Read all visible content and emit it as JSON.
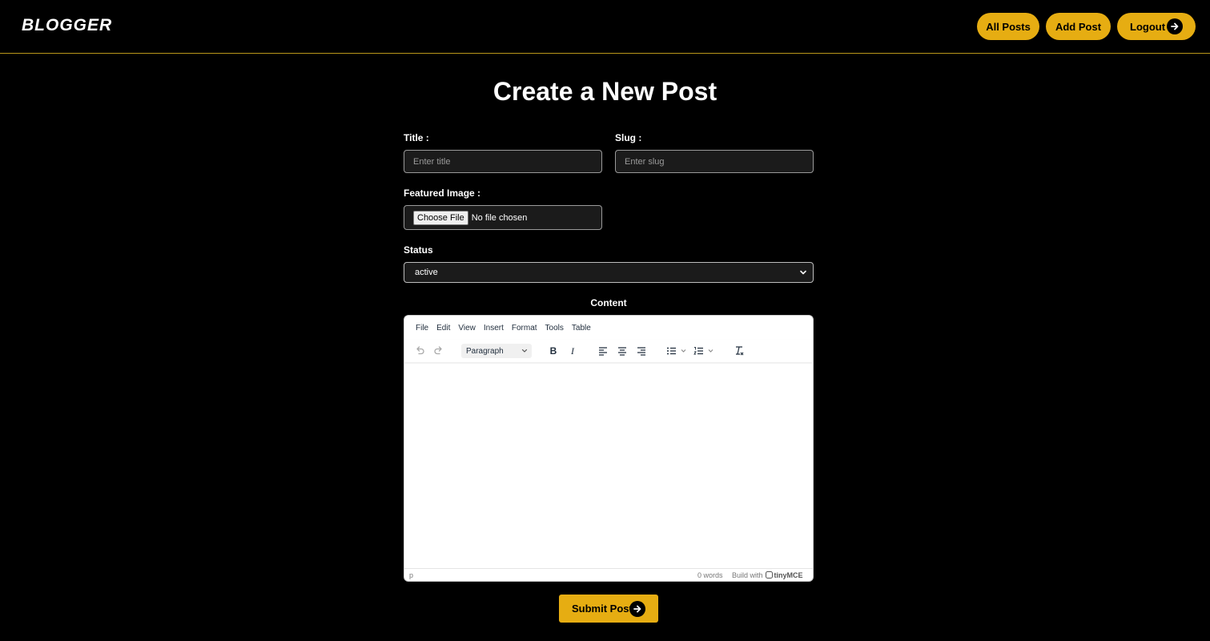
{
  "header": {
    "brand": "BLOGGER",
    "nav": {
      "all_posts": "All Posts",
      "add_post": "Add Post",
      "logout": "Logout"
    }
  },
  "page": {
    "title": "Create a New Post"
  },
  "form": {
    "title_label": "Title :",
    "title_placeholder": "Enter title",
    "slug_label": "Slug :",
    "slug_placeholder": "Enter slug",
    "image_label": "Featured Image :",
    "file_button": "Choose File",
    "file_status": "No file chosen",
    "status_label": "Status",
    "status_value": "active",
    "content_label": "Content"
  },
  "editor": {
    "menu": [
      "File",
      "Edit",
      "View",
      "Insert",
      "Format",
      "Tools",
      "Table"
    ],
    "block_format": "Paragraph",
    "status_path": "p",
    "word_count": "0 words",
    "build_with": "Build with",
    "brand": "tinyMCE"
  },
  "submit": {
    "label": "Submit Post"
  },
  "colors": {
    "accent": "#e6ad12",
    "background": "#000000",
    "input_bg": "#1b1b1b"
  }
}
